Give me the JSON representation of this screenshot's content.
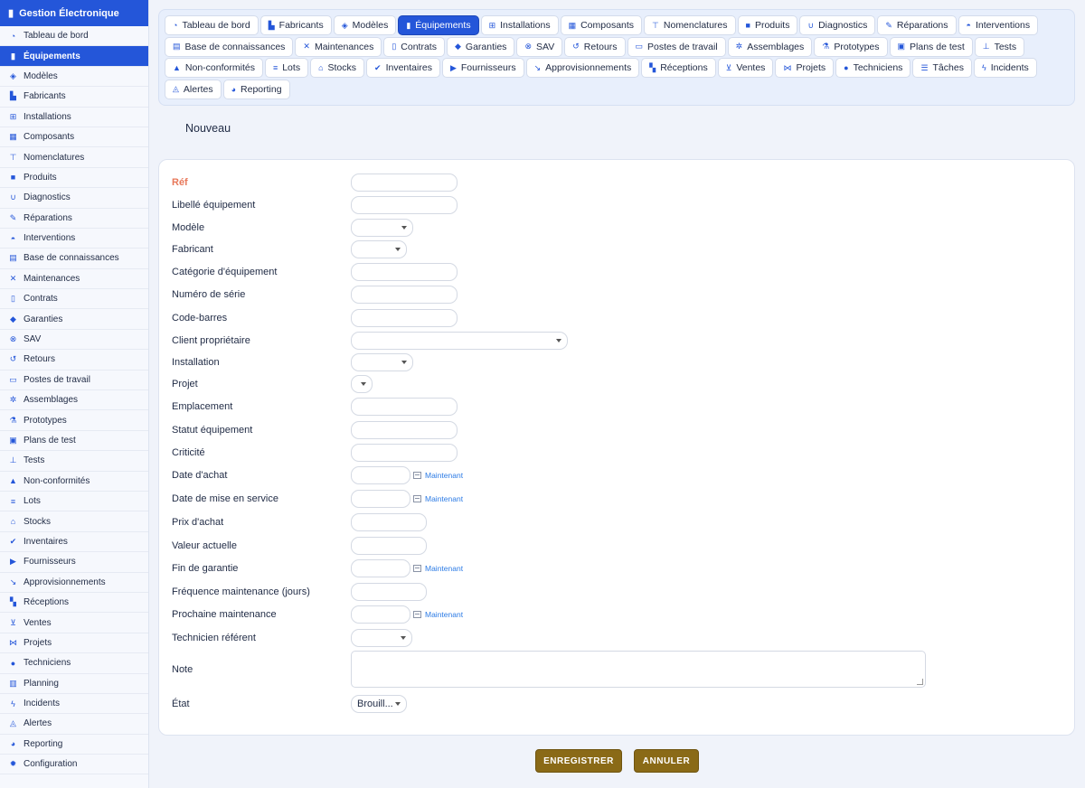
{
  "app": {
    "title": "Gestion Électronique"
  },
  "sidebar": {
    "items": [
      {
        "label": "Tableau de bord",
        "icon": "dashboard-icon",
        "active": false
      },
      {
        "label": "Équipements",
        "icon": "equipment-icon",
        "active": true
      },
      {
        "label": "Modèles",
        "icon": "cube-icon",
        "active": false
      },
      {
        "label": "Fabricants",
        "icon": "factory-icon",
        "active": false
      },
      {
        "label": "Installations",
        "icon": "network-icon",
        "active": false
      },
      {
        "label": "Composants",
        "icon": "memory-icon",
        "active": false
      },
      {
        "label": "Nomenclatures",
        "icon": "sitemap-icon",
        "active": false
      },
      {
        "label": "Produits",
        "icon": "box-icon",
        "active": false
      },
      {
        "label": "Diagnostics",
        "icon": "stethoscope-icon",
        "active": false
      },
      {
        "label": "Réparations",
        "icon": "wrench-icon",
        "active": false
      },
      {
        "label": "Interventions",
        "icon": "helmet-icon",
        "active": false
      },
      {
        "label": "Base de connaissances",
        "icon": "book-icon",
        "active": false
      },
      {
        "label": "Maintenances",
        "icon": "tools-icon",
        "active": false
      },
      {
        "label": "Contrats",
        "icon": "file-icon",
        "active": false
      },
      {
        "label": "Garanties",
        "icon": "shield-icon",
        "active": false
      },
      {
        "label": "SAV",
        "icon": "support-icon",
        "active": false
      },
      {
        "label": "Retours",
        "icon": "undo-icon",
        "active": false
      },
      {
        "label": "Postes de travail",
        "icon": "monitor-icon",
        "active": false
      },
      {
        "label": "Assemblages",
        "icon": "gears-icon",
        "active": false
      },
      {
        "label": "Prototypes",
        "icon": "flask-icon",
        "active": false
      },
      {
        "label": "Plans de test",
        "icon": "clipboard-icon",
        "active": false
      },
      {
        "label": "Tests",
        "icon": "vial-icon",
        "active": false
      },
      {
        "label": "Non-conformités",
        "icon": "warning-icon",
        "active": false
      },
      {
        "label": "Lots",
        "icon": "barcode-icon",
        "active": false
      },
      {
        "label": "Stocks",
        "icon": "warehouse-icon",
        "active": false
      },
      {
        "label": "Inventaires",
        "icon": "clipboard-check-icon",
        "active": false
      },
      {
        "label": "Fournisseurs",
        "icon": "truck-icon",
        "active": false
      },
      {
        "label": "Approvisionnements",
        "icon": "dolly-icon",
        "active": false
      },
      {
        "label": "Réceptions",
        "icon": "pallet-icon",
        "active": false
      },
      {
        "label": "Ventes",
        "icon": "cart-icon",
        "active": false
      },
      {
        "label": "Projets",
        "icon": "project-diagram-icon",
        "active": false
      },
      {
        "label": "Techniciens",
        "icon": "users-cog-icon",
        "active": false
      },
      {
        "label": "Planning",
        "icon": "calendar-icon",
        "active": false
      },
      {
        "label": "Incidents",
        "icon": "bolt-icon",
        "active": false
      },
      {
        "label": "Alertes",
        "icon": "bell-icon",
        "active": false
      },
      {
        "label": "Reporting",
        "icon": "pie-chart-icon",
        "active": false
      },
      {
        "label": "Configuration",
        "icon": "gear-icon",
        "active": false
      }
    ]
  },
  "tabs": [
    {
      "label": "Tableau de bord",
      "icon": "dashboard-icon",
      "active": false
    },
    {
      "label": "Fabricants",
      "icon": "factory-icon",
      "active": false
    },
    {
      "label": "Modèles",
      "icon": "cube-icon",
      "active": false
    },
    {
      "label": "Équipements",
      "icon": "equipment-icon",
      "active": true
    },
    {
      "label": "Installations",
      "icon": "network-icon",
      "active": false
    },
    {
      "label": "Composants",
      "icon": "memory-icon",
      "active": false
    },
    {
      "label": "Nomenclatures",
      "icon": "sitemap-icon",
      "active": false
    },
    {
      "label": "Produits",
      "icon": "box-icon",
      "active": false
    },
    {
      "label": "Diagnostics",
      "icon": "stethoscope-icon",
      "active": false
    },
    {
      "label": "Réparations",
      "icon": "wrench-icon",
      "active": false
    },
    {
      "label": "Interventions",
      "icon": "helmet-icon",
      "active": false
    },
    {
      "label": "Base de connaissances",
      "icon": "book-icon",
      "active": false
    },
    {
      "label": "Maintenances",
      "icon": "tools-icon",
      "active": false
    },
    {
      "label": "Contrats",
      "icon": "file-icon",
      "active": false
    },
    {
      "label": "Garanties",
      "icon": "shield-icon",
      "active": false
    },
    {
      "label": "SAV",
      "icon": "support-icon",
      "active": false
    },
    {
      "label": "Retours",
      "icon": "undo-icon",
      "active": false
    },
    {
      "label": "Postes de travail",
      "icon": "monitor-icon",
      "active": false
    },
    {
      "label": "Assemblages",
      "icon": "gears-icon",
      "active": false
    },
    {
      "label": "Prototypes",
      "icon": "flask-icon",
      "active": false
    },
    {
      "label": "Plans de test",
      "icon": "clipboard-icon",
      "active": false
    },
    {
      "label": "Tests",
      "icon": "vial-icon",
      "active": false
    },
    {
      "label": "Non-conformités",
      "icon": "warning-icon",
      "active": false
    },
    {
      "label": "Lots",
      "icon": "barcode-icon",
      "active": false
    },
    {
      "label": "Stocks",
      "icon": "warehouse-icon",
      "active": false
    },
    {
      "label": "Inventaires",
      "icon": "clipboard-check-icon",
      "active": false
    },
    {
      "label": "Fournisseurs",
      "icon": "truck-icon",
      "active": false
    },
    {
      "label": "Approvisionnements",
      "icon": "dolly-icon",
      "active": false
    },
    {
      "label": "Réceptions",
      "icon": "pallet-icon",
      "active": false
    },
    {
      "label": "Ventes",
      "icon": "cart-icon",
      "active": false
    },
    {
      "label": "Projets",
      "icon": "project-diagram-icon",
      "active": false
    },
    {
      "label": "Techniciens",
      "icon": "users-cog-icon",
      "active": false
    },
    {
      "label": "Tâches",
      "icon": "list-icon",
      "active": false
    },
    {
      "label": "Incidents",
      "icon": "bolt-icon",
      "active": false
    },
    {
      "label": "Alertes",
      "icon": "bell-icon",
      "active": false
    },
    {
      "label": "Reporting",
      "icon": "pie-chart-icon",
      "active": false
    }
  ],
  "page": {
    "title": "Nouveau"
  },
  "form": {
    "now_label": "Maintenant",
    "fields": [
      {
        "label": "Réf",
        "type": "text",
        "value": "",
        "required": true
      },
      {
        "label": "Libellé équipement",
        "type": "text",
        "value": ""
      },
      {
        "label": "Modèle",
        "type": "select",
        "value": ""
      },
      {
        "label": "Fabricant",
        "type": "select",
        "value": ""
      },
      {
        "label": "Catégorie d'équipement",
        "type": "text",
        "value": ""
      },
      {
        "label": "Numéro de série",
        "type": "text",
        "value": ""
      },
      {
        "label": "Code-barres",
        "type": "text",
        "value": ""
      },
      {
        "label": "Client propriétaire",
        "type": "select",
        "value": ""
      },
      {
        "label": "Installation",
        "type": "select",
        "value": ""
      },
      {
        "label": "Projet",
        "type": "select",
        "value": ""
      },
      {
        "label": "Emplacement",
        "type": "text",
        "value": ""
      },
      {
        "label": "Statut équipement",
        "type": "text",
        "value": ""
      },
      {
        "label": "Criticité",
        "type": "text",
        "value": ""
      },
      {
        "label": "Date d'achat",
        "type": "date",
        "value": ""
      },
      {
        "label": "Date de mise en service",
        "type": "date",
        "value": ""
      },
      {
        "label": "Prix d'achat",
        "type": "number",
        "value": ""
      },
      {
        "label": "Valeur actuelle",
        "type": "number",
        "value": ""
      },
      {
        "label": "Fin de garantie",
        "type": "date",
        "value": ""
      },
      {
        "label": "Fréquence maintenance (jours)",
        "type": "number",
        "value": ""
      },
      {
        "label": "Prochaine maintenance",
        "type": "date",
        "value": ""
      },
      {
        "label": "Technicien référent",
        "type": "select",
        "value": ""
      },
      {
        "label": "Note",
        "type": "textarea",
        "value": ""
      },
      {
        "label": "État",
        "type": "select",
        "value": "Brouill..."
      }
    ]
  },
  "actions": {
    "save": "ENREGISTRER",
    "cancel": "ANNULER"
  }
}
